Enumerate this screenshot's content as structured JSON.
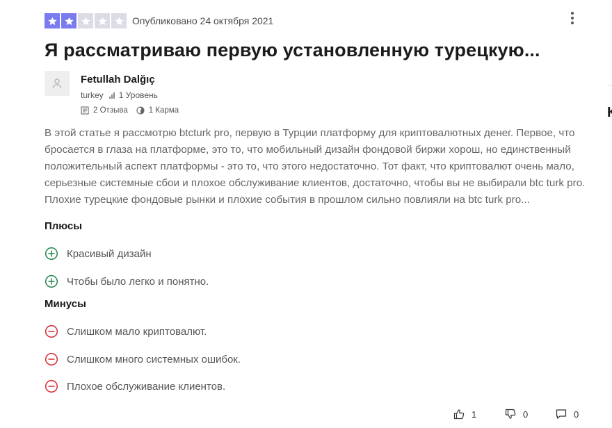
{
  "review": {
    "rating": {
      "value": 2,
      "max": 5
    },
    "published": "Опубликовано 24 октября 2021",
    "title": "Я рассматриваю первую установленную турецкую...",
    "author": {
      "name": "Fetullah  Dalğıç",
      "country": "turkey",
      "level": "1 Уровень",
      "reviews": "2 Отзыва",
      "karma": "1 Карма"
    },
    "text": "В этой статье я рассмотрю btcturk pro, первую в Турции платформу для криптовалютных денег. Первое, что бросается в глаза на платформе, это то, что мобильный дизайн фондовой биржи хорош, но единственный положительный аспект платформы - это то, что этого недостаточно. Тот факт, что криптовалют очень мало, серьезные системные сбои и плохое обслуживание клиентов, достаточно, чтобы вы не выбирали btc turk pro. Плохие турецкие фондовые рынки и плохие события в прошлом сильно повлияли на btc turk pro...",
    "pros": {
      "title": "Плюсы",
      "items": [
        "Красивый дизайн",
        "Чтобы было легко и понятно."
      ]
    },
    "cons": {
      "title": "Минусы",
      "items": [
        "Слишком мало криптовалют.",
        "Слишком много системных ошибок.",
        "Плохое обслуживание клиентов."
      ]
    },
    "actions": {
      "likes": "1",
      "dislikes": "0",
      "comments": "0"
    }
  },
  "sidebar": {
    "partial_letter": "К"
  },
  "colors": {
    "star_on": "#7b7bf0",
    "star_off": "#dcdce6",
    "plus": "#2e8b57",
    "minus": "#d9363e"
  }
}
